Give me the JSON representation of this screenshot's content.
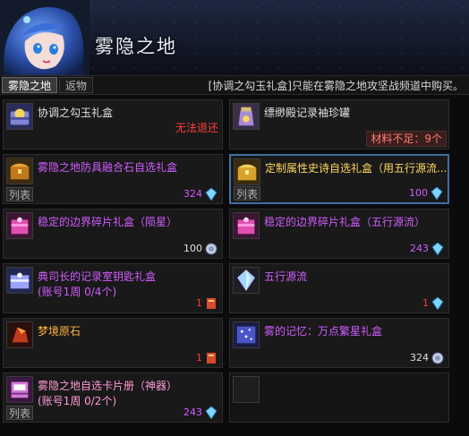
{
  "header": {
    "title": "雾隐之地"
  },
  "tabs": [
    {
      "label": "雾隐之地",
      "active": true
    },
    {
      "label": "返物",
      "active": false
    }
  ],
  "notice": "[协调之勾玉礼盒]只能在雾隐之地攻坚战频道中购买。",
  "items": [
    {
      "name": "协调之勾玉礼盒",
      "color": "white",
      "status": "无法退还",
      "icon": "orb-box-icon"
    },
    {
      "name": "缥缈殿记录袖珍罐",
      "color": "white",
      "shortage": "材料不足：9个",
      "icon": "jar-icon"
    },
    {
      "name": "雾隐之地防具融合石自选礼盒",
      "color": "purple",
      "list_label": "列表",
      "price": "324",
      "currency_icon": "crystal-icon",
      "icon": "chest-icon"
    },
    {
      "name": "定制属性史诗自选礼盒（用五行源流...",
      "color": "yellow",
      "list_label": "列表",
      "price": "100",
      "currency_icon": "crystal-icon",
      "icon": "chest-gold-icon",
      "selected": true
    },
    {
      "name": "稳定的边界碎片礼盒（陨星）",
      "color": "purple",
      "price": "100",
      "currency_icon": "silver-coin-icon",
      "icon": "pink-box-icon"
    },
    {
      "name": "稳定的边界碎片礼盒（五行源流）",
      "color": "purple",
      "price": "243",
      "currency_icon": "crystal-icon",
      "icon": "pink-box-icon"
    },
    {
      "name": "典司长的记录室钥匙礼盒",
      "color": "purple",
      "sub": "(账号1周 0/4个)",
      "price": "1",
      "currency_icon": "bookmark-icon",
      "icon": "key-box-icon"
    },
    {
      "name": "五行源流",
      "color": "purple",
      "price": "1",
      "currency_icon": "crystal-icon",
      "icon": "crystal-item-icon"
    },
    {
      "name": "梦境原石",
      "color": "orange",
      "price": "1",
      "currency_icon": "bookmark-icon",
      "icon": "dream-stone-icon"
    },
    {
      "name": "雾的记忆：万点繁星礼盒",
      "color": "purple",
      "price": "324",
      "currency_icon": "silver-coin-icon",
      "icon": "memory-box-icon"
    },
    {
      "name": "雾隐之地自选卡片册（神器）",
      "color": "pink",
      "sub": "(账号1周 0/2个)",
      "list_label": "列表",
      "price": "243",
      "currency_icon": "crystal-icon",
      "icon": "card-album-icon"
    }
  ]
}
